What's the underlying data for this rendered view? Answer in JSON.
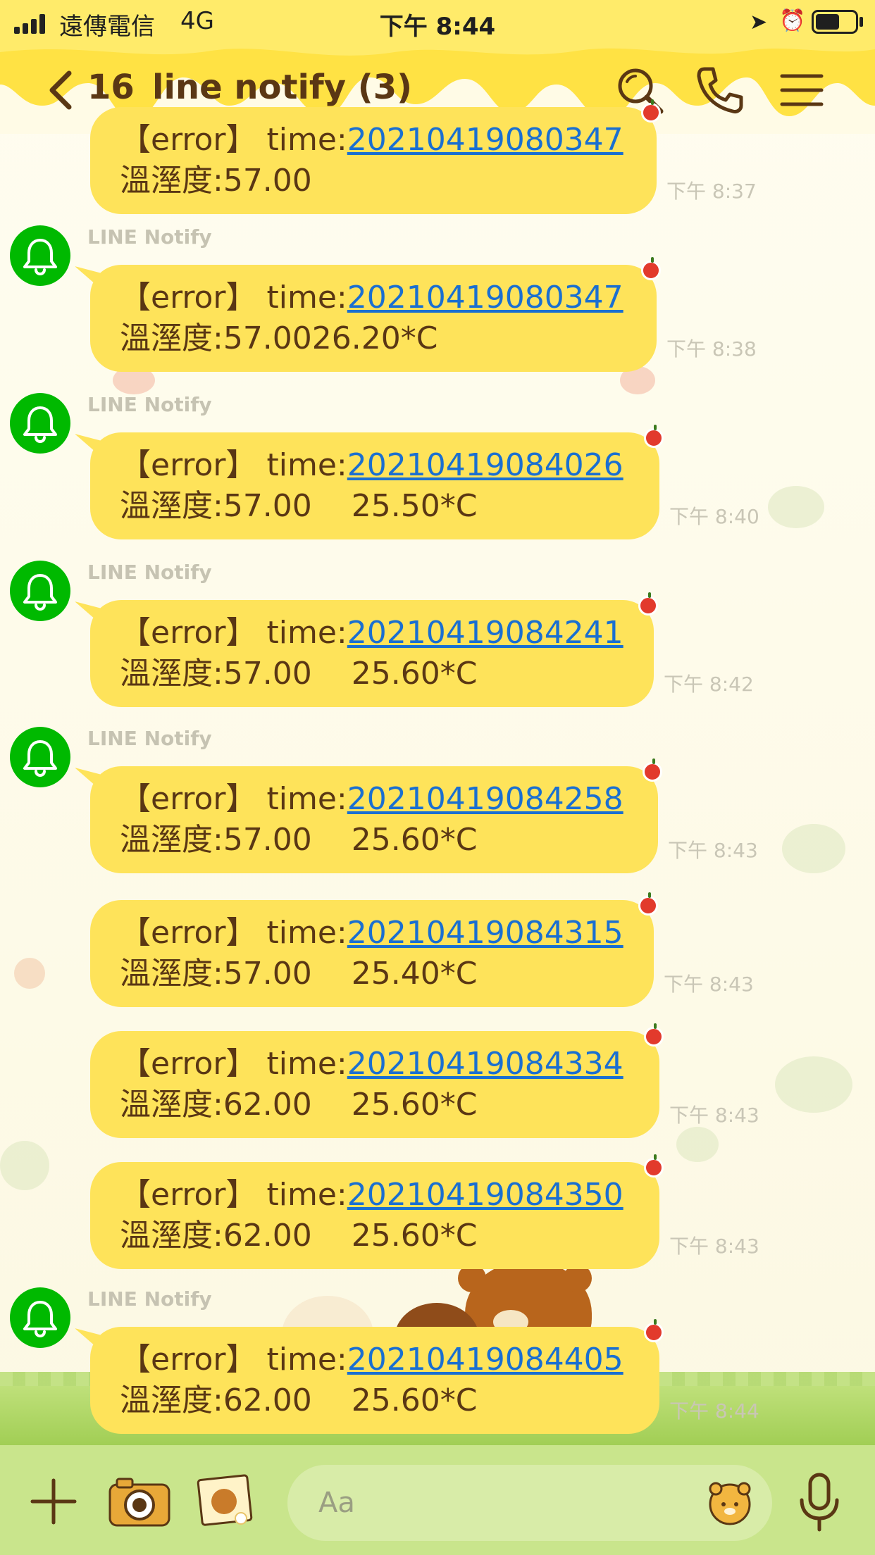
{
  "status_bar": {
    "carrier": "遠傳電信",
    "network": "4G",
    "time": "下午 8:44",
    "battery_level": 0.55
  },
  "nav": {
    "back_count": "16",
    "title": "line notify (3)",
    "icons": [
      "search-icon",
      "call-icon",
      "menu-icon"
    ]
  },
  "messages": [
    {
      "sender": "",
      "line1_prefix": "【error】 time:",
      "link": "20210419080347",
      "line2": "溫溼度:57.00",
      "time": "下午 8:37"
    },
    {
      "sender": "LINE Notify",
      "line1_prefix": "【error】 time:",
      "link": "20210419080347",
      "line2": "溫溼度:57.0026.20*C",
      "time": "下午 8:38"
    },
    {
      "sender": "LINE Notify",
      "line1_prefix": "【error】 time:",
      "link": "20210419084026",
      "line2": "溫溼度:57.00    25.50*C",
      "time": "下午 8:40"
    },
    {
      "sender": "LINE Notify",
      "line1_prefix": "【error】 time:",
      "link": "20210419084241",
      "line2": "溫溼度:57.00    25.60*C",
      "time": "下午 8:42"
    },
    {
      "sender": "LINE Notify",
      "line1_prefix": "【error】 time:",
      "link": "20210419084258",
      "line2": "溫溼度:57.00    25.60*C",
      "time": "下午 8:43"
    },
    {
      "sender": "",
      "line1_prefix": "【error】 time:",
      "link": "20210419084315",
      "line2": "溫溼度:57.00    25.40*C",
      "time": "下午 8:43"
    },
    {
      "sender": "",
      "line1_prefix": "【error】 time:",
      "link": "20210419084334",
      "line2": "溫溼度:62.00    25.60*C",
      "time": "下午 8:43"
    },
    {
      "sender": "",
      "line1_prefix": "【error】 time:",
      "link": "20210419084350",
      "line2": "溫溼度:62.00    25.60*C",
      "time": "下午 8:43"
    },
    {
      "sender": "LINE Notify",
      "line1_prefix": "【error】 time:",
      "link": "20210419084405",
      "line2": "溫溼度:62.00    25.60*C",
      "time": "下午 8:44"
    }
  ],
  "input_bar": {
    "placeholder": "Aa",
    "icons": [
      "plus-icon",
      "camera-icon",
      "gallery-icon",
      "sticker-icon",
      "mic-icon"
    ]
  },
  "colors": {
    "bubble": "#fee35a",
    "text": "#5a3714",
    "link": "#1a6fd1",
    "avatar": "#00b900",
    "input_bar": "#c9e58c"
  }
}
